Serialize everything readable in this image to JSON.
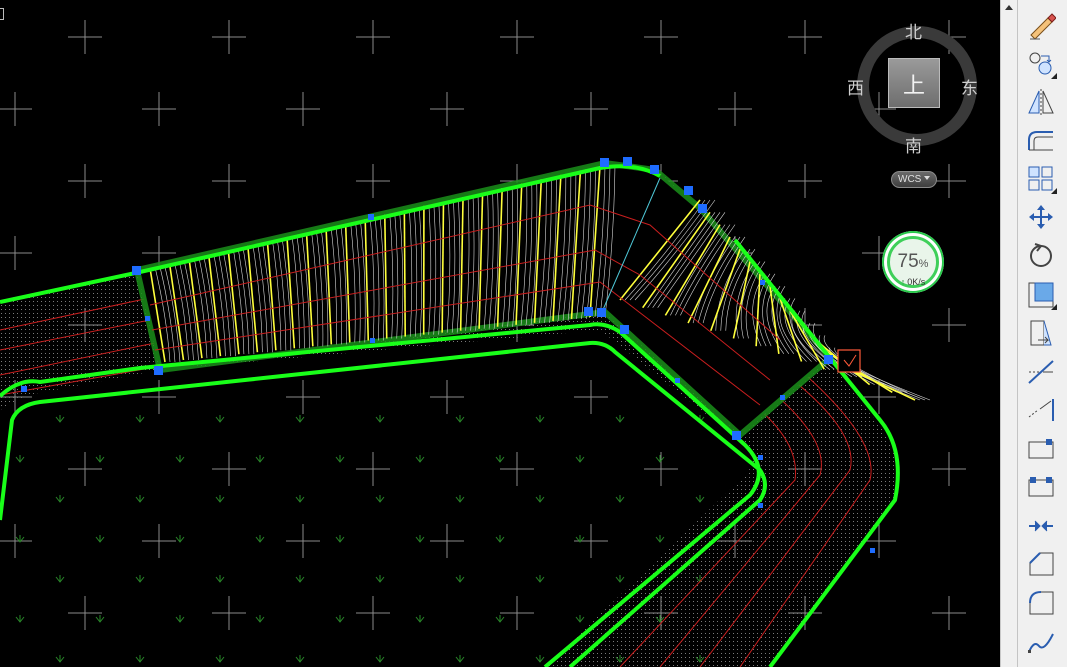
{
  "viewcube": {
    "face_label": "上",
    "north": "北",
    "south": "南",
    "west": "西",
    "east": "东"
  },
  "wcs": {
    "label": "WCS"
  },
  "performance": {
    "percent": "75",
    "percent_unit": "%",
    "speed": "0K/s"
  },
  "colors": {
    "background": "#000000",
    "boundary": "#19ff19",
    "hatch_yellow": "#ffff3c",
    "contour_red": "#d42020",
    "grip_blue": "#1e6cff",
    "toolbar_bg": "#f0f0f0"
  },
  "toolbar": {
    "tools": [
      {
        "icon": "erase-icon"
      },
      {
        "icon": "copy-icon"
      },
      {
        "icon": "mirror-icon"
      },
      {
        "icon": "offset-icon"
      },
      {
        "icon": "array-icon"
      },
      {
        "icon": "move-icon"
      },
      {
        "icon": "rotate-icon"
      },
      {
        "icon": "scale-icon"
      },
      {
        "icon": "stretch-icon"
      },
      {
        "icon": "trim-icon"
      },
      {
        "icon": "extend-icon"
      },
      {
        "icon": "break-at-point-icon"
      },
      {
        "icon": "break-icon"
      },
      {
        "icon": "join-icon"
      },
      {
        "icon": "chamfer-icon"
      },
      {
        "icon": "fillet-icon"
      },
      {
        "icon": "blend-curves-icon"
      }
    ]
  }
}
